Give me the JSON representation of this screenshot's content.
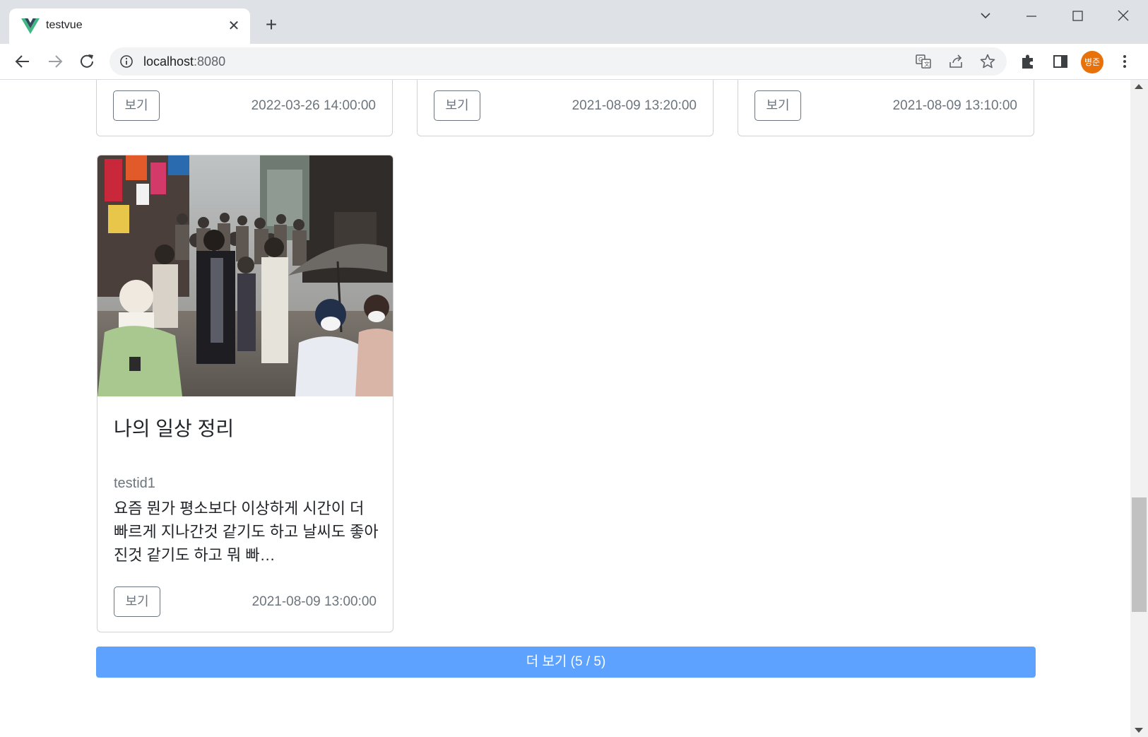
{
  "browser": {
    "tab_title": "testvue",
    "url_host": "localhost",
    "url_port": ":8080",
    "avatar_text": "병준"
  },
  "cards_top": [
    {
      "button": "보기",
      "date": "2022-03-26 14:00:00"
    },
    {
      "button": "보기",
      "date": "2021-08-09 13:20:00"
    },
    {
      "button": "보기",
      "date": "2021-08-09 13:10:00"
    }
  ],
  "card_main": {
    "title": "나의 일상 정리",
    "author": "testid1",
    "text": "요즘 뭔가 평소보다 이상하게 시간이 더 빠르게 지나간것 같기도 하고 날씨도 좋아진것 같기도 하고 뭐 빠…",
    "button": "보기",
    "date": "2021-08-09 13:00:00"
  },
  "more_button": "더 보기 (5 / 5)",
  "colors": {
    "accent": "#5ea2ff",
    "avatar": "#e8710a",
    "vue_green": "#41b883",
    "vue_dark": "#34495e"
  }
}
